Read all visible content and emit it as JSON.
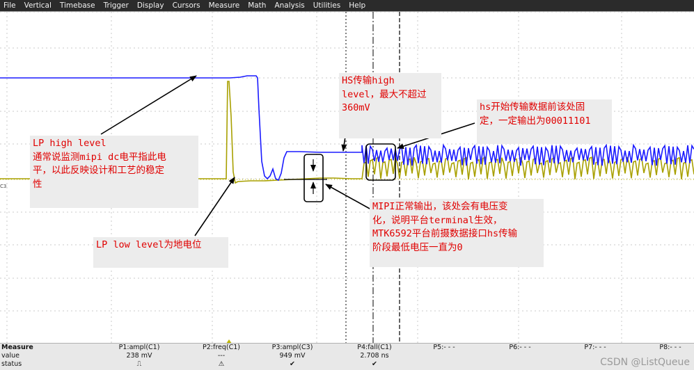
{
  "menu": [
    "File",
    "Vertical",
    "Timebase",
    "Trigger",
    "Display",
    "Cursors",
    "Measure",
    "Math",
    "Analysis",
    "Utilities",
    "Help"
  ],
  "colors": {
    "ch1": "#1a1aff",
    "ch3": "#a8a000",
    "annotation_text": "#e00000",
    "annotation_bg": "#ececec",
    "arrow": "#000000"
  },
  "channel_marker": "C3",
  "annotations": [
    {
      "id": "lp_high",
      "text": "LP high level\n通常说监测mipi dc电平指此电\n平，以此反映设计和工艺的稳定\n性"
    },
    {
      "id": "lp_low",
      "text": "LP low level为地电位"
    },
    {
      "id": "hs_high",
      "text": "HS传输high\nlevel，最大不超过\n360mV"
    },
    {
      "id": "hs_start",
      "text": "hs开始传输数据前该处固\n定，一定输出为00011101"
    },
    {
      "id": "mipi_normal",
      "text": "MIPI正常输出，该处会有电压变\n化，说明平台terminal生效，\nMTK6592平台前摄数据接口hs传输\n阶段最低电压一直为0"
    }
  ],
  "measure": {
    "title": "Measure",
    "row_labels": [
      "value",
      "status"
    ],
    "columns": [
      {
        "param": "P1:ampl(C1)",
        "value": "238 mV",
        "status": "⎍"
      },
      {
        "param": "P2:freq(C1)",
        "value": "---",
        "status": "⚠"
      },
      {
        "param": "P3:ampl(C3)",
        "value": "949 mV",
        "status": "✔"
      },
      {
        "param": "P4:fall(C1)",
        "value": "2.708 ns",
        "status": "✔"
      },
      {
        "param": "P5:- - -",
        "value": "",
        "status": ""
      },
      {
        "param": "P6:- - -",
        "value": "",
        "status": ""
      },
      {
        "param": "P7:- - -",
        "value": "",
        "status": ""
      },
      {
        "param": "P8:- - -",
        "value": "",
        "status": ""
      }
    ]
  },
  "watermark": "CSDN @ListQueue"
}
